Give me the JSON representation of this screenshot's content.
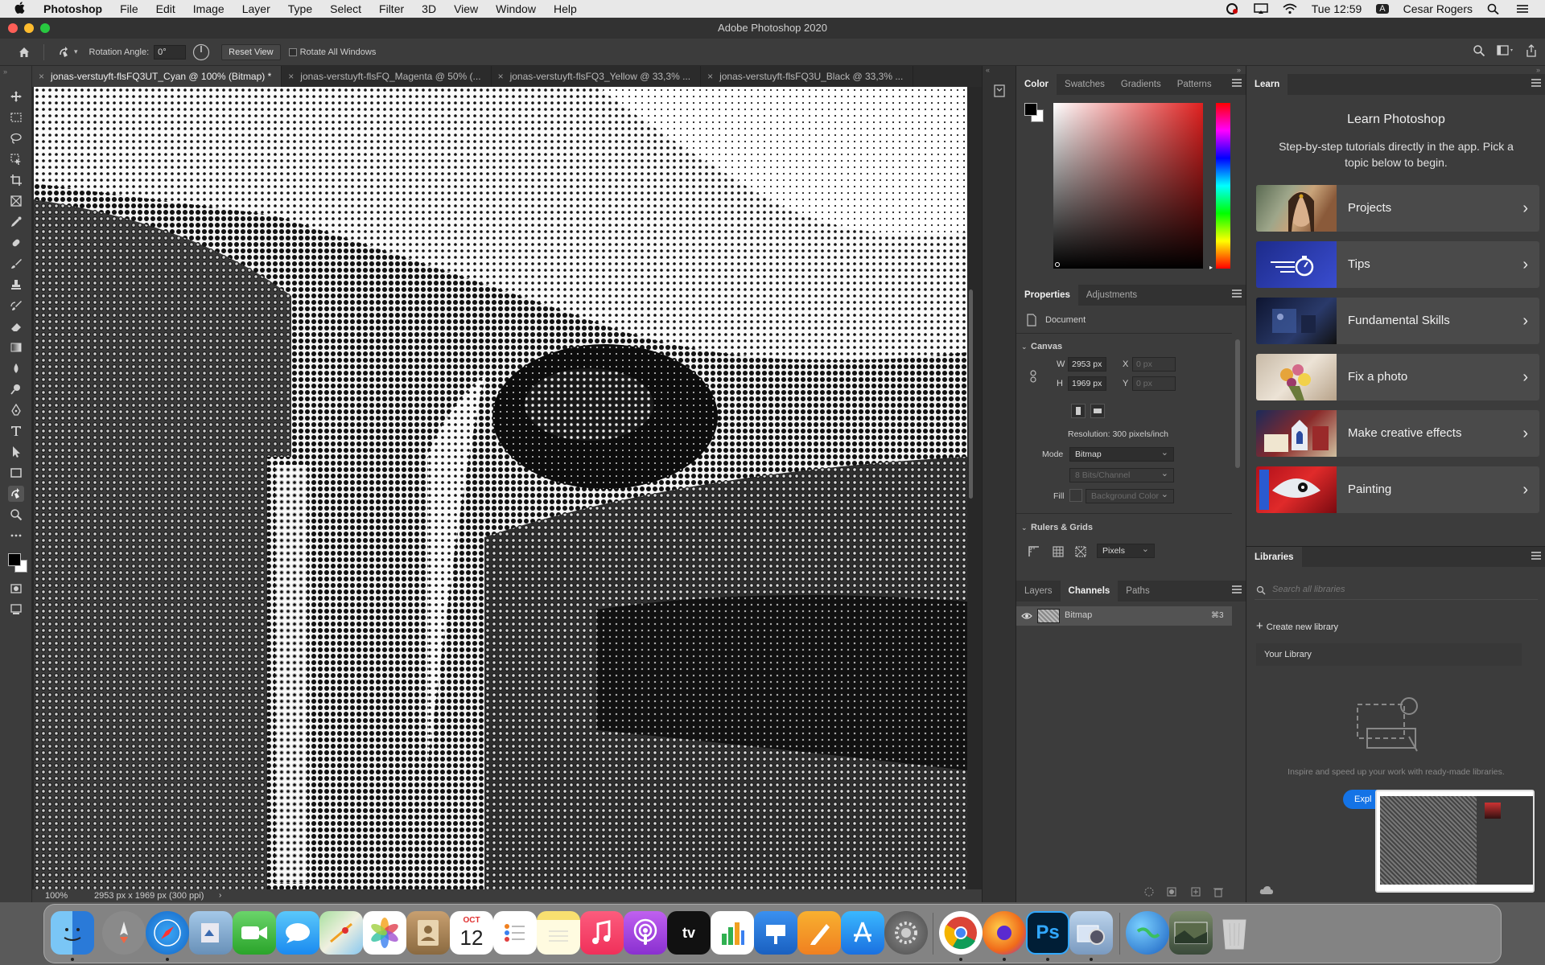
{
  "menubar": {
    "items": [
      "Photoshop",
      "File",
      "Edit",
      "Image",
      "Layer",
      "Type",
      "Select",
      "Filter",
      "3D",
      "View",
      "Window",
      "Help"
    ],
    "clock": "Tue 12:59",
    "user": "Cesar Rogers",
    "input_badge": "A"
  },
  "window": {
    "title": "Adobe Photoshop 2020"
  },
  "options": {
    "rotation_label": "Rotation Angle:",
    "rotation_value": "0°",
    "reset_view": "Reset View",
    "rotate_all": "Rotate All Windows"
  },
  "tabs": [
    {
      "label": "jonas-verstuyft-flsFQ3UT_Cyan @ 100% (Bitmap) *"
    },
    {
      "label": "jonas-verstuyft-flsFQ_Magenta @ 50% (..."
    },
    {
      "label": "jonas-verstuyft-flsFQ3_Yellow @ 33,3% ..."
    },
    {
      "label": "jonas-verstuyft-flsFQ3U_Black @ 33,3% ..."
    }
  ],
  "status": {
    "zoom": "100%",
    "doc_info": "2953 px x 1969 px (300 ppi)"
  },
  "color_panel": {
    "tabs": [
      "Color",
      "Swatches",
      "Gradients",
      "Patterns"
    ],
    "hue_color": "#e0201f"
  },
  "properties": {
    "tabs": [
      "Properties",
      "Adjustments"
    ],
    "document_label": "Document",
    "canvas_header": "Canvas",
    "w_label": "W",
    "w_value": "2953 px",
    "h_label": "H",
    "h_value": "1969 px",
    "x_label": "X",
    "x_value": "0 px",
    "y_label": "Y",
    "y_value": "0 px",
    "resolution": "Resolution: 300 pixels/inch",
    "mode_label": "Mode",
    "mode_value": "Bitmap",
    "bits_value": "8 Bits/Channel",
    "fill_label": "Fill",
    "fill_value": "Background Color",
    "rulers_header": "Rulers & Grids",
    "units_value": "Pixels"
  },
  "layers_panel": {
    "tabs": [
      "Layers",
      "Channels",
      "Paths"
    ],
    "channel_name": "Bitmap",
    "channel_shortcut": "⌘3"
  },
  "learn": {
    "tab": "Learn",
    "title": "Learn Photoshop",
    "subtitle": "Step-by-step tutorials directly in the app. Pick a topic below to begin.",
    "cards": [
      {
        "label": "Projects"
      },
      {
        "label": "Tips"
      },
      {
        "label": "Fundamental Skills"
      },
      {
        "label": "Fix a photo"
      },
      {
        "label": "Make creative effects"
      },
      {
        "label": "Painting"
      }
    ]
  },
  "libraries": {
    "tab": "Libraries",
    "search_placeholder": "Search all libraries",
    "create_label": "Create new library",
    "your_library": "Your Library",
    "promo": "Inspire and speed up your work with ready-made libraries.",
    "explore_label": "Expl"
  },
  "dock": {
    "calendar_month": "OCT",
    "calendar_day": "12",
    "ps_label": "Ps",
    "tv_label": "tv"
  }
}
